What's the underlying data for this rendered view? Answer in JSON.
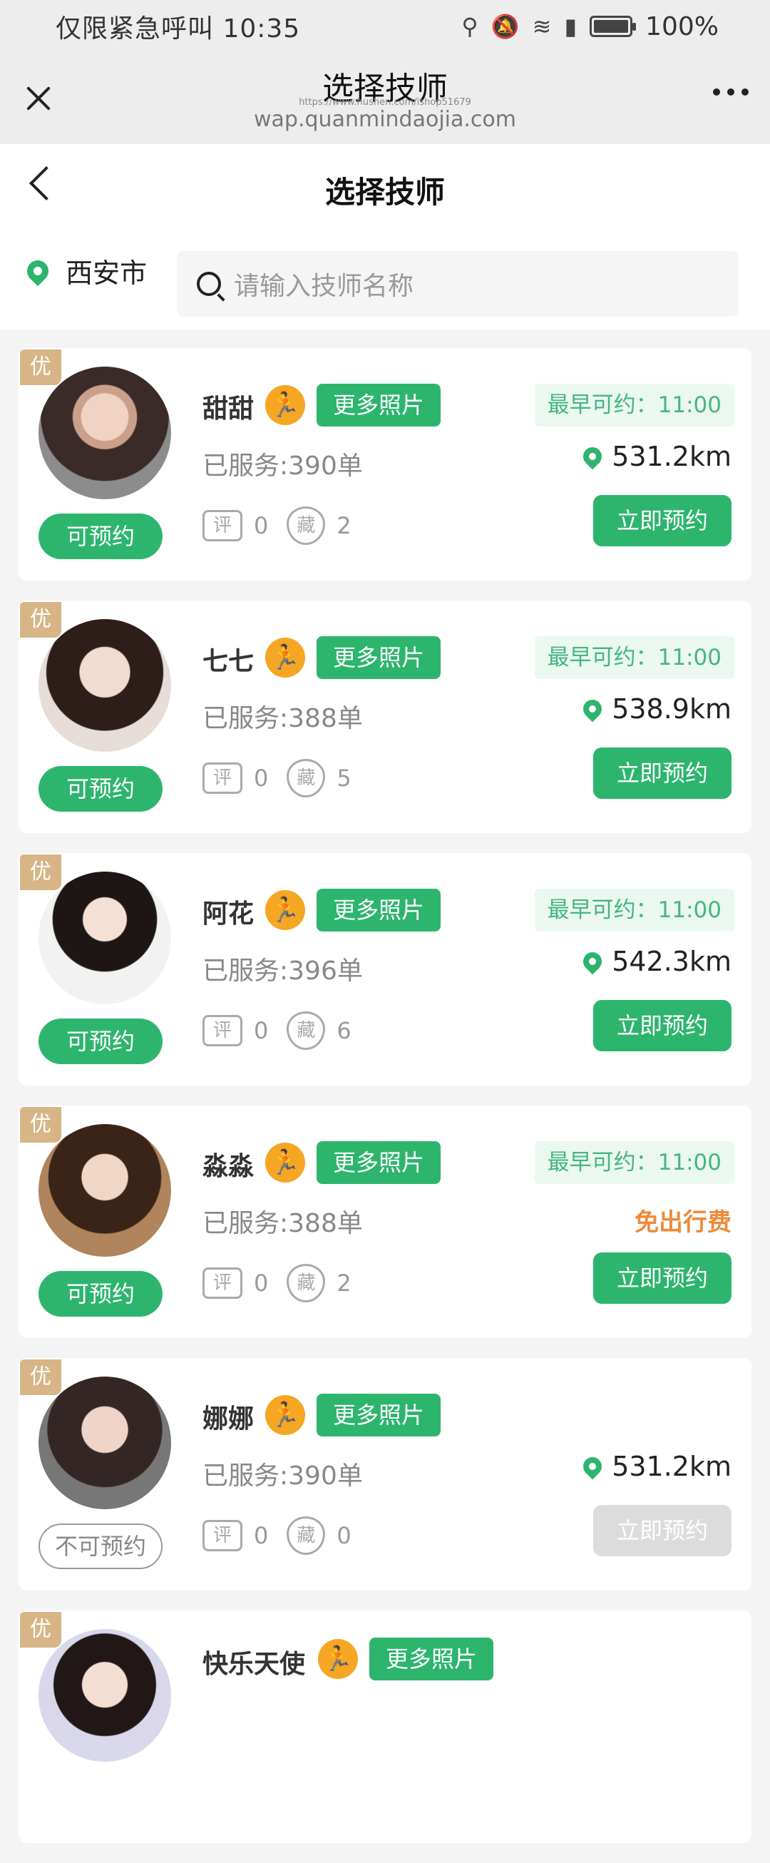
{
  "status_bar": {
    "carrier": "仅限紧急呼叫",
    "time": "10:35",
    "battery": "100%",
    "battery_level": 1.0
  },
  "wx_header": {
    "title": "选择技师",
    "url_small": "https://www.hushen.com/ishop51679",
    "url": "wap.quanmindaojia.com"
  },
  "page": {
    "title": "选择技师",
    "city": "西安市",
    "search_placeholder": "请输入技师名称"
  },
  "labels": {
    "more_photos": "更多照片",
    "earliest_prefix": "最早可约：",
    "book": "立即预约",
    "review_icon": "评",
    "fav_icon": "藏",
    "premium_badge": "优"
  },
  "technicians": [
    {
      "name": "甜甜",
      "served": "已服务:390单",
      "reviews": "0",
      "favorites": "2",
      "earliest": "11:00",
      "distance": "531.2km",
      "status": "可预约",
      "available": true
    },
    {
      "name": "七七",
      "served": "已服务:388单",
      "reviews": "0",
      "favorites": "5",
      "earliest": "11:00",
      "distance": "538.9km",
      "status": "可预约",
      "available": true
    },
    {
      "name": "阿花",
      "served": "已服务:396单",
      "reviews": "0",
      "favorites": "6",
      "earliest": "11:00",
      "distance": "542.3km",
      "status": "可预约",
      "available": true
    },
    {
      "name": "淼淼",
      "served": "已服务:388单",
      "reviews": "0",
      "favorites": "2",
      "earliest": "11:00",
      "distance_note": "免出行费",
      "status": "可预约",
      "available": true
    },
    {
      "name": "娜娜",
      "served": "已服务:390单",
      "reviews": "0",
      "favorites": "0",
      "distance": "531.2km",
      "status": "不可预约",
      "available": false
    },
    {
      "name": "快乐天使"
    }
  ],
  "colors": {
    "primary_green": "#2db56e",
    "badge_gold": "#d7b587",
    "runner_orange": "#f5a623",
    "free_orange": "#ee8a3a",
    "earliest_bg": "#eaf8f0"
  }
}
